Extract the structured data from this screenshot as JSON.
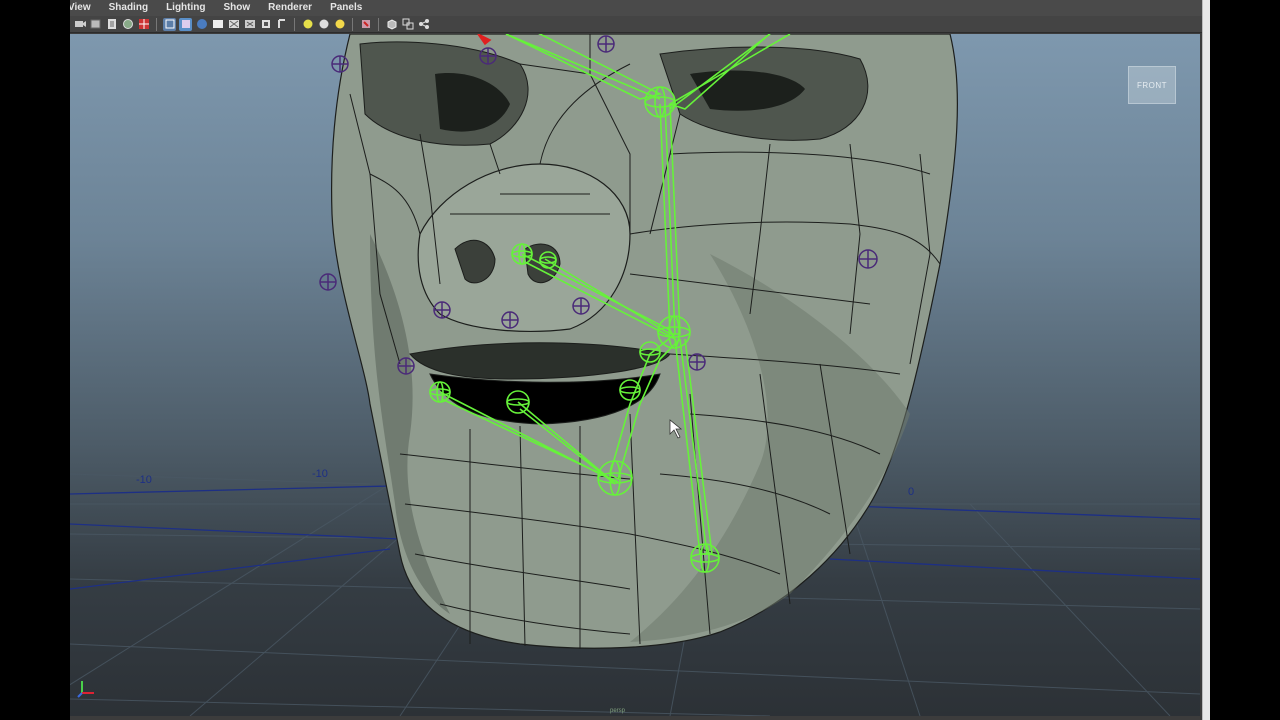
{
  "menubar": {
    "items": [
      {
        "label": "View"
      },
      {
        "label": "Shading"
      },
      {
        "label": "Lighting"
      },
      {
        "label": "Show"
      },
      {
        "label": "Renderer"
      },
      {
        "label": "Panels"
      }
    ]
  },
  "toolbar": {
    "icons": [
      "camera-select-icon",
      "camera-attributes-icon",
      "bookmark-icon",
      "image-plane-icon",
      "grid-toggle-icon",
      "wireframe-icon",
      "smooth-shade-icon",
      "textured-icon",
      "default-lighting-icon",
      "all-lights-icon",
      "isolate-select-icon",
      "xray-icon",
      "resolution-gate-icon"
    ]
  },
  "viewport": {
    "viewcube_label": "FRONT",
    "grid_labels": [
      {
        "text": "-10"
      },
      {
        "text": "-10"
      },
      {
        "text": "0"
      }
    ],
    "camera_label": "persp",
    "colors": {
      "joint": "#66f23a",
      "locator": "#4a2a78",
      "mesh": "#8f9b8e",
      "grid_axis": "#1d2f85"
    }
  }
}
